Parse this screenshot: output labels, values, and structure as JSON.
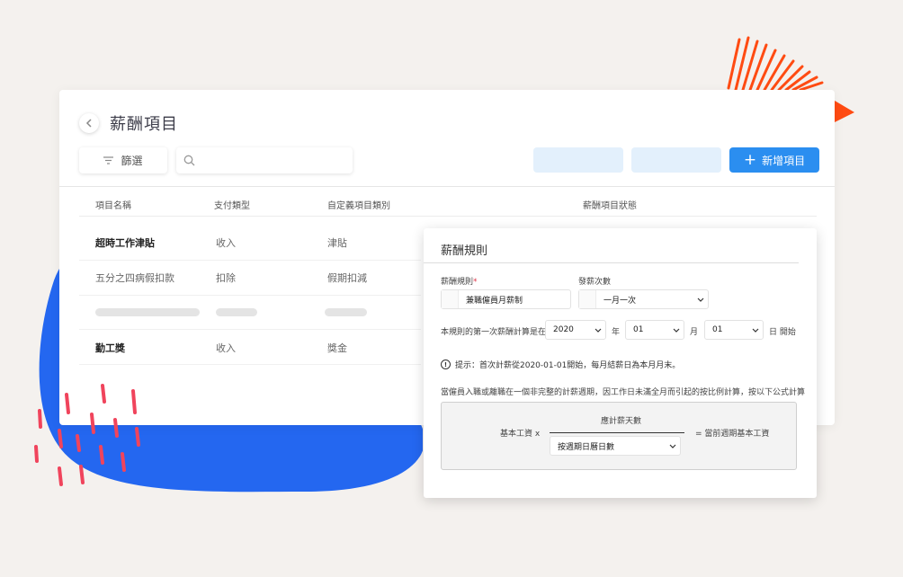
{
  "colors": {
    "primary": "#2b8ef0",
    "placeholder_button": "#e3f0fc",
    "blob": "#2467f0",
    "accent_orange": "#ff4b12",
    "dash_pink": "#f0445c"
  },
  "page": {
    "title": "薪酬項目"
  },
  "toolbar": {
    "filter_label": "篩選",
    "search_placeholder": "",
    "add_label": "新增項目"
  },
  "table": {
    "headers": [
      "項目名稱",
      "支付類型",
      "自定義項目類別",
      "薪酬項目狀態"
    ],
    "rows": [
      {
        "name": "超時工作津貼",
        "type": "收入",
        "category": "津貼"
      },
      {
        "name": "五分之四病假扣款",
        "type": "扣除",
        "category": "假期扣減"
      },
      {
        "name": "勤工獎",
        "type": "收入",
        "category": "獎金"
      }
    ]
  },
  "rule_panel": {
    "title": "薪酬規則",
    "rule_label": "薪酬規則",
    "required_mark": "*",
    "rule_value": "兼職僱員月薪制",
    "frequency_label": "發薪次數",
    "frequency_value": "一月一次",
    "first_calc_text": "本規則的第一次薪酬計算是在",
    "year_value": "2020",
    "year_unit": "年",
    "month_value": "01",
    "month_unit": "月",
    "day_value": "01",
    "day_unit": "日 開始",
    "hint": "提示：首次計薪從2020-01-01開始，每月結薪日為本月月末。",
    "prorate_text": "當僱員入職或離職在一個非完整的計薪週期，因工作日未滿全月而引起的按比例計算，按以下公式計算",
    "formula": {
      "left": "基本工資 x",
      "numerator": "應計薪天數",
      "denominator": "按週期日曆日數",
      "right": "= 當前週期基本工資"
    }
  },
  "icons": {
    "back": "chevron-left-icon",
    "filter": "filter-icon",
    "search": "search-icon",
    "info": "info-icon",
    "dropdown": "chevron-down-icon"
  }
}
